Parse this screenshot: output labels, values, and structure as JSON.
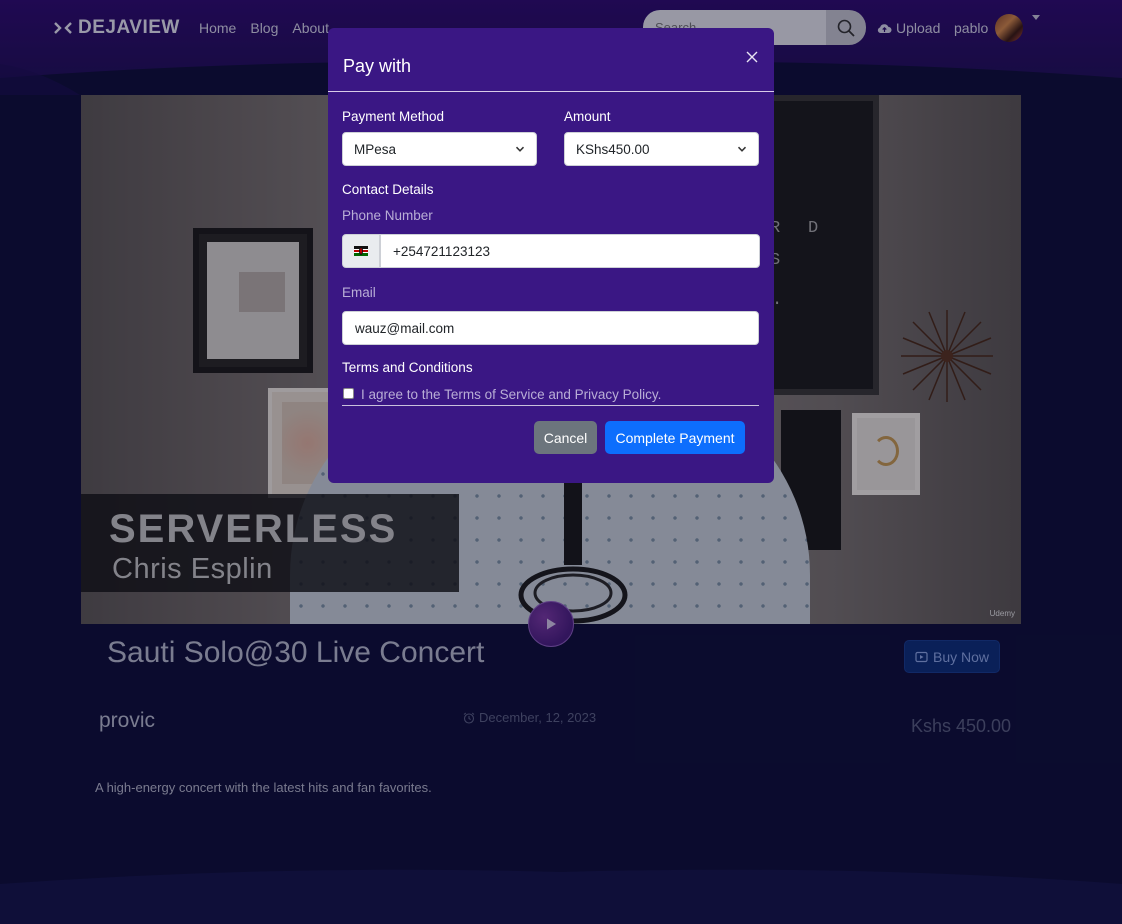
{
  "navbar": {
    "brand": "DEJAVIEW",
    "links": [
      "Home",
      "Blog",
      "About"
    ],
    "search_placeholder": "Search",
    "upload_label": "Upload",
    "username": "pablo"
  },
  "video": {
    "title_line1": "SERVERLESS",
    "title_line2": "Chris Esplin",
    "watermark": "Udemy",
    "letterboard": [
      "R",
      "D",
      "S",
      "."
    ]
  },
  "event": {
    "title": "Sauti Solo@30 Live Concert",
    "buy_label": "Buy Now",
    "location": "provic",
    "date": "December, 12, 2023",
    "price": "Kshs 450.00",
    "description": "A high-energy concert with the latest hits and fan favorites."
  },
  "modal": {
    "title": "Pay with",
    "payment_method_label": "Payment Method",
    "payment_method_value": "MPesa",
    "amount_label": "Amount",
    "amount_value": "KShs450.00",
    "contact_label": "Contact Details",
    "phone_label": "Phone Number",
    "phone_value": "+254721123123",
    "email_label": "Email",
    "email_value": "wauz@mail.com",
    "terms_label": "Terms and Conditions",
    "terms_text": "I agree to the Terms of Service and Privacy Policy.",
    "cancel_label": "Cancel",
    "complete_label": "Complete Payment"
  },
  "colors": {
    "page_bg": "#0e0f3a",
    "nav_bg": "#2c0c6b",
    "modal_bg": "#3a1784",
    "primary": "#0d6efd",
    "secondary": "#6c757d"
  }
}
